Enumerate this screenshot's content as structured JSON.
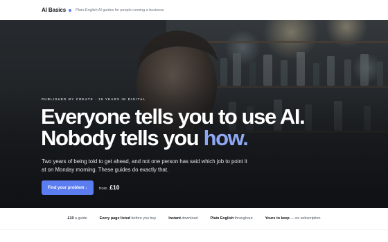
{
  "header": {
    "brand": "AI Basics",
    "tagline": "Plain-English AI guides for people running a business"
  },
  "hero": {
    "eyebrow": "PUBLISHED BY CREATE · 25 YEARS IN DIGITAL",
    "headline_line1": "Everyone tells you to use AI.",
    "headline_line2_start": "Nobody tells you ",
    "headline_line2_accent": "how.",
    "subtext": "Two years of being told to get ahead, and not one person has said which job to point it at on Monday morning. These guides do exactly that.",
    "cta_label": "Find your problem ↓",
    "price_prefix": "from",
    "price": "£10"
  },
  "features": [
    {
      "strong": "£10",
      "rest": " a guide"
    },
    {
      "strong": "Every page listed",
      "rest": " before you buy"
    },
    {
      "strong": "Instant",
      "rest": " download"
    },
    {
      "strong": "Plain English",
      "rest": " throughout"
    },
    {
      "strong": "Yours to keep",
      "rest": " — no subscription"
    }
  ],
  "colors": {
    "accent": "#5b7df0",
    "accent_text": "#8ea8f4",
    "brand_dot": "#5b7df0"
  },
  "icons": {
    "cta_arrow": "arrow-down-icon",
    "brand_dot": "dot-icon"
  }
}
